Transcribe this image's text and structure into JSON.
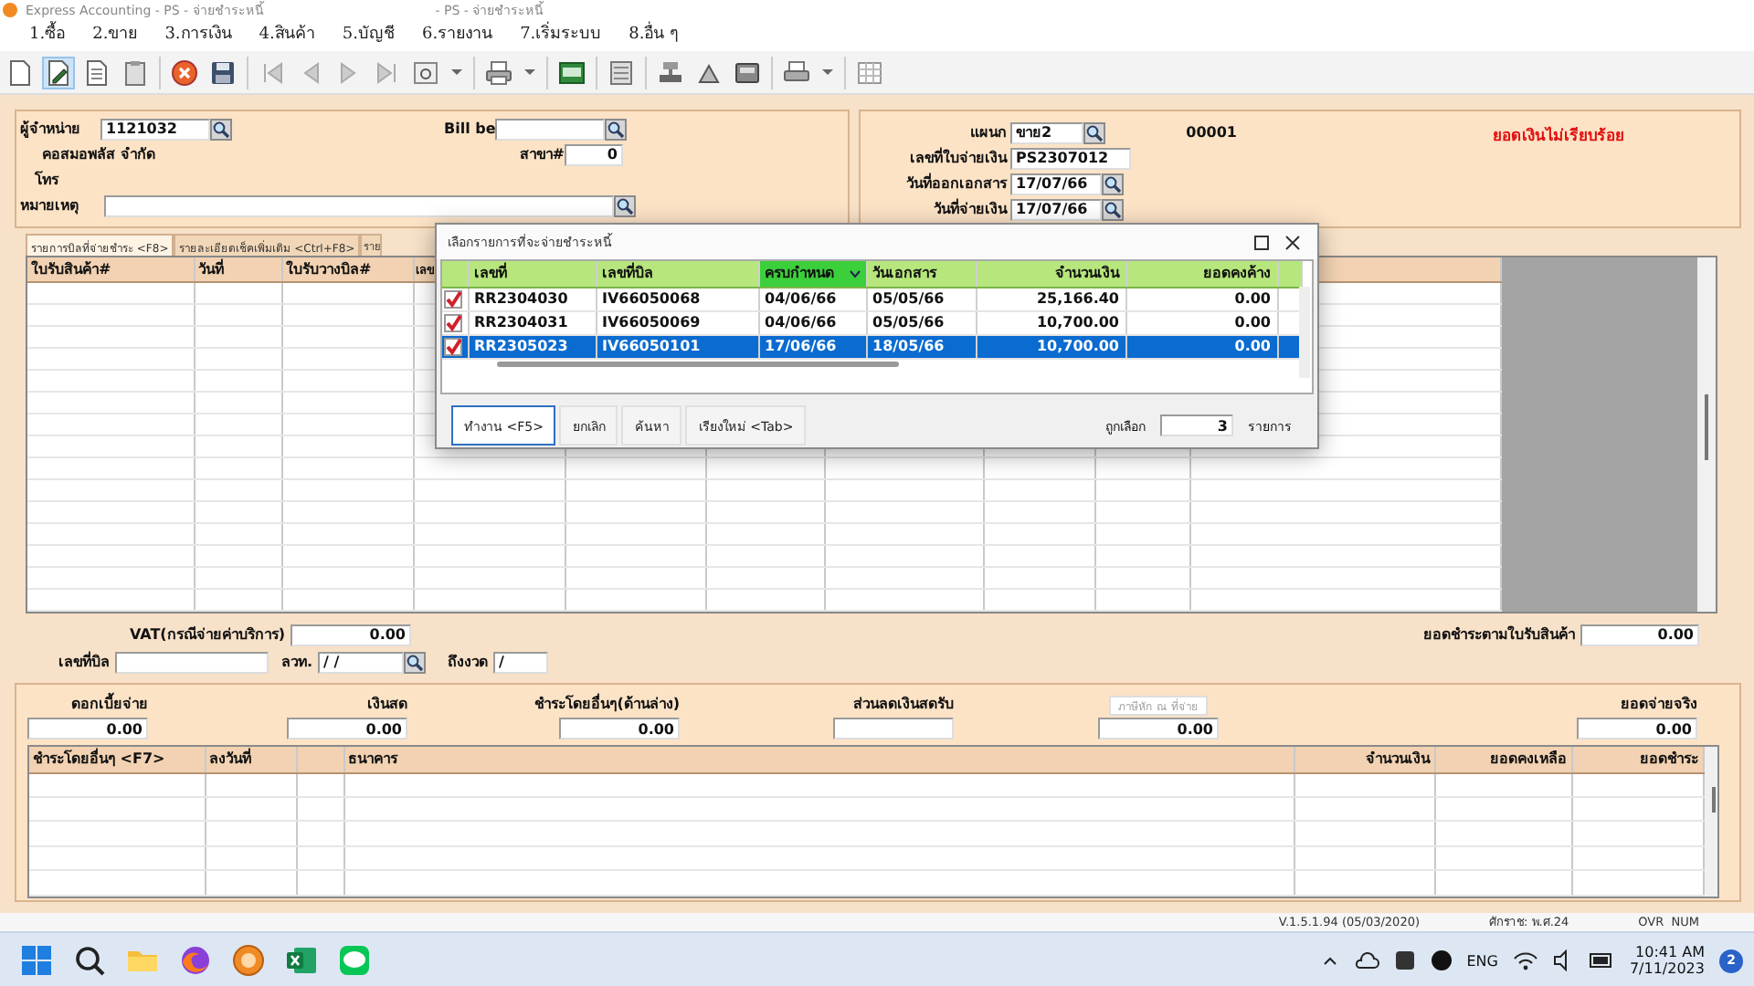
{
  "window": {
    "title": "Express Accounting - PS - จ่ายชำระหนี้",
    "title_extra": "- PS - จ่ายชำระหนี้"
  },
  "menu": [
    "1.ซื้อ",
    "2.ขาย",
    "3.การเงิน",
    "4.สินค้า",
    "5.บัญชี",
    "6.รายงาน",
    "7.เริ่มระบบ",
    "8.อื่น ๆ"
  ],
  "header": {
    "supplier": {
      "label": "ผู้จำหน่าย",
      "value": "1121032"
    },
    "supplier_name": "คอสมอพลัส จำกัด",
    "phone_label": "โทร",
    "note_label": "หมายเหตุ",
    "bill_be_label": "Bill be",
    "branch": {
      "label": "สาขา#",
      "value": "0"
    },
    "department": {
      "label": "แผนก",
      "value": "ขาย2",
      "code": "00001"
    },
    "payment_no": {
      "label": "เลขที่ใบจ่ายเงิน",
      "value": "PS2307012"
    },
    "doc_date": {
      "label": "วันที่ออกเอกสาร",
      "value": "17/07/66"
    },
    "pay_date": {
      "label": "วันที่จ่ายเงิน",
      "value": "17/07/66"
    },
    "status": "ยอดเงินไม่เรียบร้อย"
  },
  "tabs": [
    {
      "label": "รายการบิลที่จ่ายชำระ <F8>",
      "selected": true
    },
    {
      "label": "รายละเอียดเช็คเพิ่มเติม <Ctrl+F8>",
      "selected": false
    },
    {
      "label": "ราย",
      "selected": false
    }
  ],
  "bills_table": {
    "columns": [
      "ใบรับสินค้า#",
      "วันที่",
      "ใบรับวางบิล#",
      "เลข"
    ]
  },
  "picker": {
    "title": "เลือกรายการที่จะจ่ายชำระหนี้",
    "columns": [
      {
        "label": "เลขที่",
        "sorted": false
      },
      {
        "label": "เลขที่บิล",
        "sorted": false
      },
      {
        "label": "ครบกำหนด",
        "sorted": true
      },
      {
        "label": "วันเอกสาร",
        "sorted": false
      },
      {
        "label": "จำนวนเงิน",
        "sorted": false
      },
      {
        "label": "ยอดคงค้าง",
        "sorted": false
      }
    ],
    "rows": [
      {
        "checked": true,
        "selected": false,
        "cells": [
          "RR2304030",
          "IV66050068",
          "04/06/66",
          "05/05/66",
          "25,166.40",
          "0.00"
        ]
      },
      {
        "checked": true,
        "selected": false,
        "cells": [
          "RR2304031",
          "IV66050069",
          "04/06/66",
          "05/05/66",
          "10,700.00",
          "0.00"
        ]
      },
      {
        "checked": true,
        "selected": true,
        "cells": [
          "RR2305023",
          "IV66050101",
          "17/06/66",
          "18/05/66",
          "10,700.00",
          "0.00"
        ]
      }
    ],
    "buttons": [
      {
        "label": "ทำงาน <F5>",
        "focused": true
      },
      {
        "label": "ยกเลิก",
        "focused": false
      },
      {
        "label": "ค้นหา",
        "focused": false
      },
      {
        "label": "เรียงใหม่ <Tab>",
        "focused": false
      }
    ],
    "count_label": "ถูกเลือก",
    "count": "3",
    "count_unit": "รายการ"
  },
  "vat": {
    "label": "VAT(กรณีจ่ายค่าบริการ)",
    "value": "0.00"
  },
  "bill_no_label": "เลขที่บิล",
  "date_label": "ลวท.",
  "date_value": "/ /",
  "period_label": "ถึงงวด",
  "period_value": "/",
  "receipt_total": {
    "label": "ยอดชำระตามใบรับสินค้า",
    "value": "0.00"
  },
  "amounts": [
    {
      "kind": "field",
      "label": "ดอกเบี้ยจ่าย",
      "value": "0.00"
    },
    {
      "kind": "field",
      "label": "เงินสด",
      "value": "0.00"
    },
    {
      "kind": "field",
      "label": "ชำระโดยอื่นๆ(ด้านล่าง)",
      "value": "0.00"
    },
    {
      "kind": "field",
      "label": "ส่วนลดเงินสดรับ"
    },
    {
      "kind": "button",
      "label": "ภาษีหัก ณ ที่จ่าย",
      "disabled": true,
      "value": "0.00"
    },
    {
      "kind": "field",
      "label": "ยอดจ่ายจริง",
      "value": "0.00"
    }
  ],
  "payments_table": {
    "columns": [
      "ชำระโดยอื่นๆ <F7>",
      "ลงวันที่",
      "ธนาคาร",
      "จำนวนเงิน",
      "ยอดคงเหลือ",
      "ยอดชำระ"
    ]
  },
  "status_bar": {
    "version": "V.1.5.1.94 (05/03/2020)",
    "era": "ศักราช: พ.ศ.24",
    "mode": "OVR  NUM"
  },
  "taskbar": {
    "language": "ENG",
    "time": "10:41 AM",
    "date": "7/11/2023",
    "notifications": "2"
  }
}
